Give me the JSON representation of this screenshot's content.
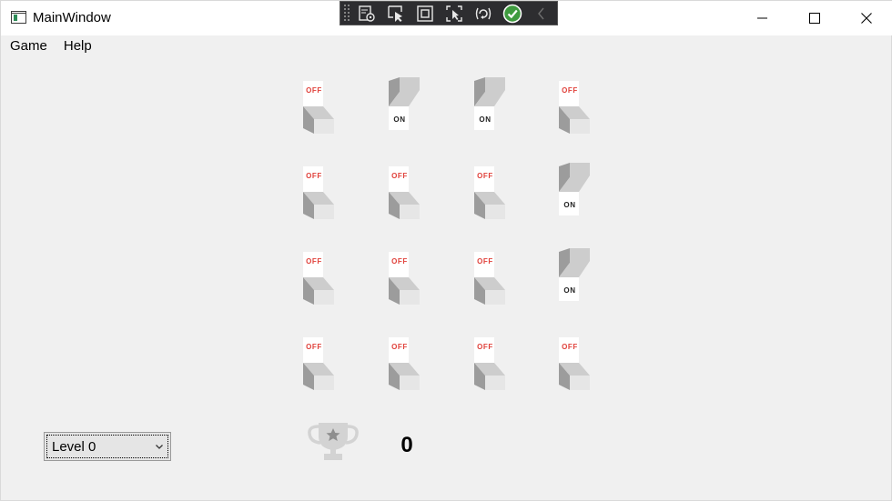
{
  "window": {
    "title": "MainWindow"
  },
  "menu": {
    "items": [
      "Game",
      "Help"
    ]
  },
  "debug_toolbar": {
    "buttons": [
      "live-visual-tree-icon",
      "select-element-icon",
      "display-layout-adorners-icon",
      "track-focus-icon",
      "hot-reload-icon",
      "status-ok-icon",
      "collapse-chevron-icon"
    ]
  },
  "board": {
    "rows": [
      [
        {
          "state": "off",
          "label": "OFF"
        },
        {
          "state": "on",
          "label": "ON"
        },
        {
          "state": "on",
          "label": "ON"
        },
        {
          "state": "off",
          "label": "OFF"
        }
      ],
      [
        {
          "state": "off",
          "label": "OFF"
        },
        {
          "state": "off",
          "label": "OFF"
        },
        {
          "state": "off",
          "label": "OFF"
        },
        {
          "state": "on",
          "label": "ON"
        }
      ],
      [
        {
          "state": "off",
          "label": "OFF"
        },
        {
          "state": "off",
          "label": "OFF"
        },
        {
          "state": "off",
          "label": "OFF"
        },
        {
          "state": "on",
          "label": "ON"
        }
      ],
      [
        {
          "state": "off",
          "label": "OFF"
        },
        {
          "state": "off",
          "label": "OFF"
        },
        {
          "state": "off",
          "label": "OFF"
        },
        {
          "state": "off",
          "label": "OFF"
        }
      ]
    ]
  },
  "level_select": {
    "selected": "Level 0"
  },
  "score": {
    "value": "0",
    "icon": "trophy-icon"
  },
  "colors": {
    "off_text": "#e0403a",
    "on_text": "#222222",
    "background": "#f0f0f0"
  }
}
